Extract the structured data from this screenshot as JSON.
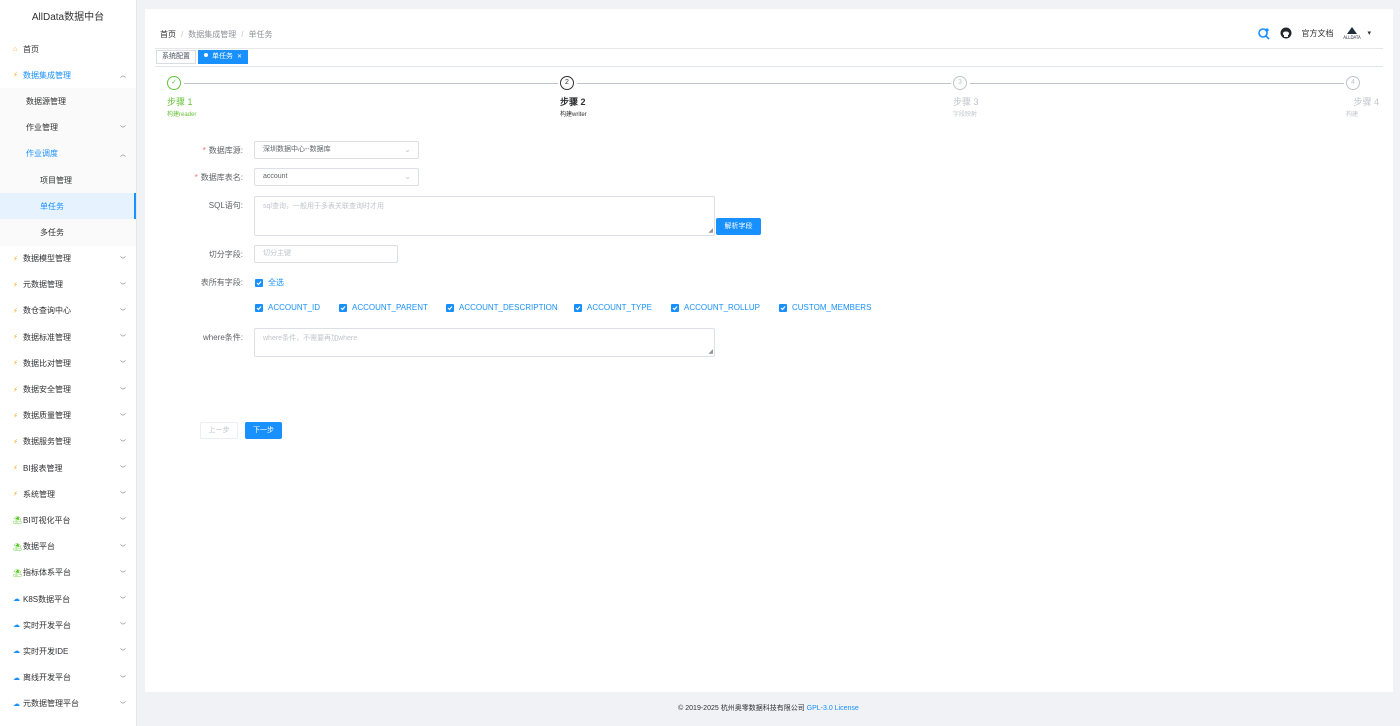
{
  "sidebar": {
    "title": "AllData数据中台",
    "items": [
      {
        "label": "首页",
        "level": 1,
        "icon": "home-icon"
      },
      {
        "label": "数据集成管理",
        "level": 1,
        "icon": "lightning-icon",
        "expanded": true
      },
      {
        "label": "数据源管理",
        "level": 2
      },
      {
        "label": "作业管理",
        "level": 2,
        "chevron": "down"
      },
      {
        "label": "作业调度",
        "level": 2,
        "chevron": "up"
      },
      {
        "label": "项目管理",
        "level": 3
      },
      {
        "label": "单任务",
        "level": 3,
        "active": true
      },
      {
        "label": "多任务",
        "level": 3
      },
      {
        "label": "数据模型管理",
        "level": 1,
        "icon": "lightning-icon"
      },
      {
        "label": "元数据管理",
        "level": 1,
        "icon": "lightning-icon"
      },
      {
        "label": "数仓查询中心",
        "level": 1,
        "icon": "lightning-icon"
      },
      {
        "label": "数据标准管理",
        "level": 1,
        "icon": "lightning-icon"
      },
      {
        "label": "数据比对管理",
        "level": 1,
        "icon": "lightning-icon"
      },
      {
        "label": "数据安全管理",
        "level": 1,
        "icon": "lightning-icon"
      },
      {
        "label": "数据质量管理",
        "level": 1,
        "icon": "lightning-icon"
      },
      {
        "label": "数据服务管理",
        "level": 1,
        "icon": "lightning-icon"
      },
      {
        "label": "BI报表管理",
        "level": 1,
        "icon": "lightning-icon"
      },
      {
        "label": "系统管理",
        "level": 1,
        "icon": "lightning-icon"
      },
      {
        "label": "BI可视化平台",
        "level": 1,
        "icon": "platform-icon"
      },
      {
        "label": "数据平台",
        "level": 1,
        "icon": "platform-icon"
      },
      {
        "label": "指标体系平台",
        "level": 1,
        "icon": "platform-icon"
      },
      {
        "label": "K8S数据平台",
        "level": 1,
        "icon": "cloud-icon"
      },
      {
        "label": "实时开发平台",
        "level": 1,
        "icon": "cloud-icon"
      },
      {
        "label": "实时开发IDE",
        "level": 1,
        "icon": "cloud-icon"
      },
      {
        "label": "离线开发平台",
        "level": 1,
        "icon": "cloud-icon"
      },
      {
        "label": "元数据管理平台",
        "level": 1,
        "icon": "cloud-icon"
      }
    ]
  },
  "breadcrumb": [
    "首页",
    "数据集成管理",
    "单任务"
  ],
  "header": {
    "docs_label": "官方文档",
    "avatar_text": "ALLDATA"
  },
  "tags": [
    {
      "label": "系统配置",
      "active": false
    },
    {
      "label": "单任务",
      "active": true
    }
  ],
  "steps": [
    {
      "title": "步骤 1",
      "desc": "构建reader",
      "status": "done",
      "number": "1"
    },
    {
      "title": "步骤 2",
      "desc": "构建writer",
      "status": "current",
      "number": "2"
    },
    {
      "title": "步骤 3",
      "desc": "字段映射",
      "status": "wait",
      "number": "3"
    },
    {
      "title": "步骤 4",
      "desc": "构建",
      "status": "wait",
      "number": "4"
    }
  ],
  "form": {
    "datasource": {
      "label": "数据库源:",
      "value": "深圳数据中心--数据库"
    },
    "table": {
      "label": "数据库表名:",
      "value": "account"
    },
    "sql": {
      "label": "SQL语句:",
      "placeholder": "sql查询，一般用于多表关联查询时才用"
    },
    "parse_button": "解析字段",
    "split": {
      "label": "切分字段:",
      "placeholder": "切分主键"
    },
    "fields": {
      "label": "表所有字段:",
      "select_all": "全选",
      "items": [
        "ACCOUNT_ID",
        "ACCOUNT_PARENT",
        "ACCOUNT_DESCRIPTION",
        "ACCOUNT_TYPE",
        "ACCOUNT_ROLLUP",
        "CUSTOM_MEMBERS"
      ]
    },
    "where": {
      "label": "where条件:",
      "placeholder": "where条件，不需要再加where"
    }
  },
  "buttons": {
    "prev": "上一步",
    "next": "下一步"
  },
  "footer": {
    "copyright": "© 2019-2025 杭州奥零数据科技有限公司",
    "license": "GPL-3.0 License"
  },
  "colors": {
    "primary": "#1890ff",
    "success": "#67c23a",
    "required": "#f56c6c"
  }
}
